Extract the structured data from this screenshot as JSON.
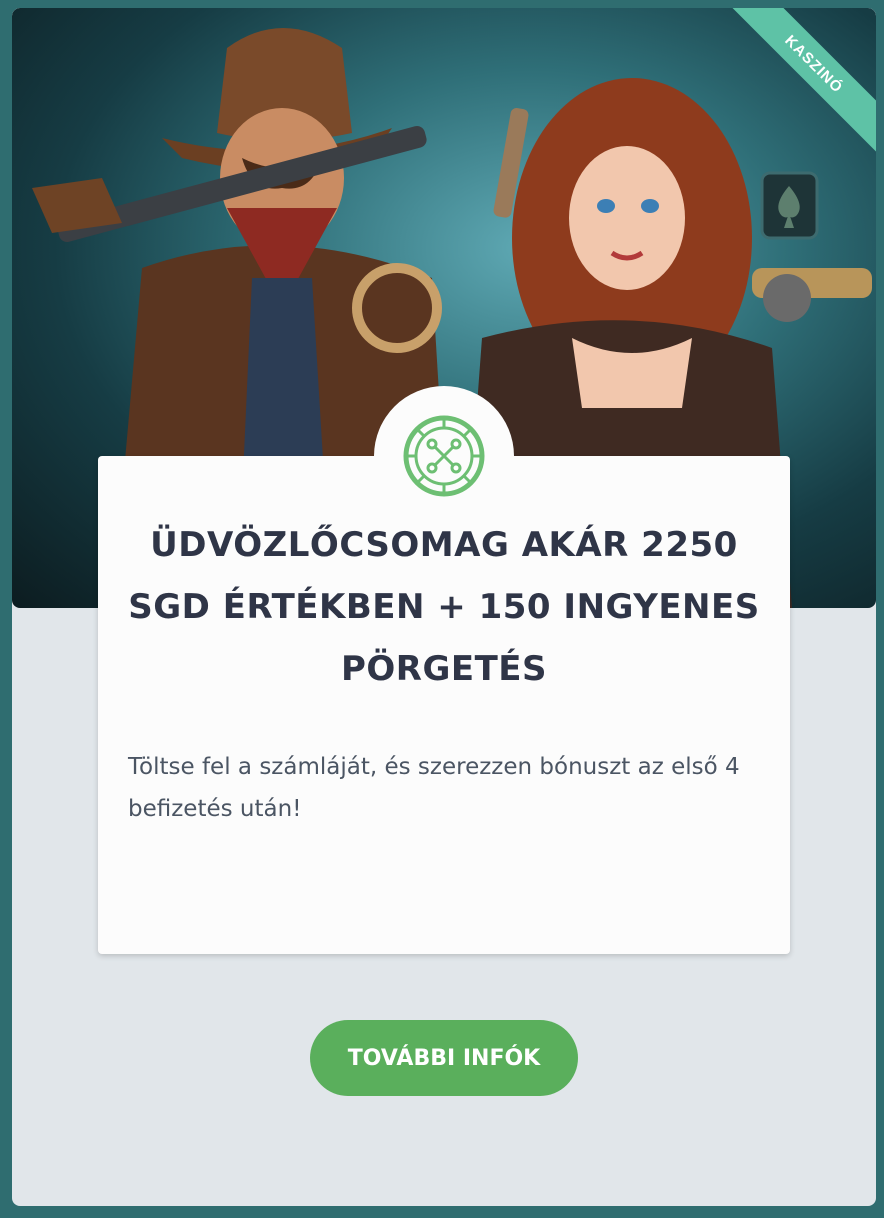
{
  "hero": {
    "corner_ribbon": "KASZINÓ",
    "image_icon": "roulette-wheel-icon"
  },
  "promo": {
    "title": "ÜDVÖZLŐCSOMAG AKÁR 2250 SGD ÉRTÉKBEN + 150 INGYENES PÖRGETÉS",
    "description": "Töltse fel a számláját, és szerezzen bónuszt az első 4 befizetés után!",
    "cta_label": "TOVÁBBI INFÓK"
  },
  "colors": {
    "accent_green": "#5aaf5c",
    "ribbon_teal": "#5ec2a6",
    "title_dark": "#2f3547"
  }
}
